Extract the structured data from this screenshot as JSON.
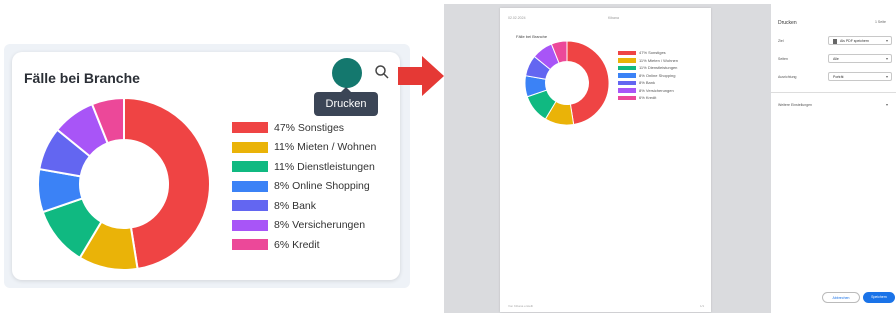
{
  "card": {
    "title": "Fälle bei Branche",
    "tooltip": "Drucken"
  },
  "legend": [
    {
      "label": "47% Sonstiges",
      "color": "#ef4444"
    },
    {
      "label": "11% Mieten / Wohnen",
      "color": "#eab308"
    },
    {
      "label": "11% Dienstleistungen",
      "color": "#10b981"
    },
    {
      "label": "8% Online Shopping",
      "color": "#3b82f6"
    },
    {
      "label": "8% Bank",
      "color": "#6366f1"
    },
    {
      "label": "8% Versicherungen",
      "color": "#a855f7"
    },
    {
      "label": "6% Kredit",
      "color": "#ec4899"
    }
  ],
  "chart_data": {
    "type": "pie",
    "categories": [
      "Sonstiges",
      "Mieten / Wohnen",
      "Dienstleistungen",
      "Online Shopping",
      "Bank",
      "Versicherungen",
      "Kredit"
    ],
    "values": [
      47,
      11,
      11,
      8,
      8,
      8,
      6
    ],
    "colors": [
      "#ef4444",
      "#eab308",
      "#10b981",
      "#3b82f6",
      "#6366f1",
      "#a855f7",
      "#ec4899"
    ],
    "title": "Fälle bei Branche",
    "unit": "%"
  },
  "print_dialog": {
    "preview": {
      "header_date": "02.02.2024",
      "header_title": "Kibana",
      "heading": "Fälle bei Branche",
      "footer": "Von Kibana erstellt",
      "page_number": "1/1"
    },
    "title": "Drucken",
    "sheet_count": "1 Seite",
    "rows": [
      {
        "label": "Ziel",
        "value": "Als PDF speichern"
      },
      {
        "label": "Seiten",
        "value": "Alle"
      },
      {
        "label": "Ausrichtung",
        "value": "Porträt"
      }
    ],
    "more_settings": "Weitere Einstellungen",
    "cancel_label": "Abbrechen",
    "save_label": "Speichern"
  }
}
